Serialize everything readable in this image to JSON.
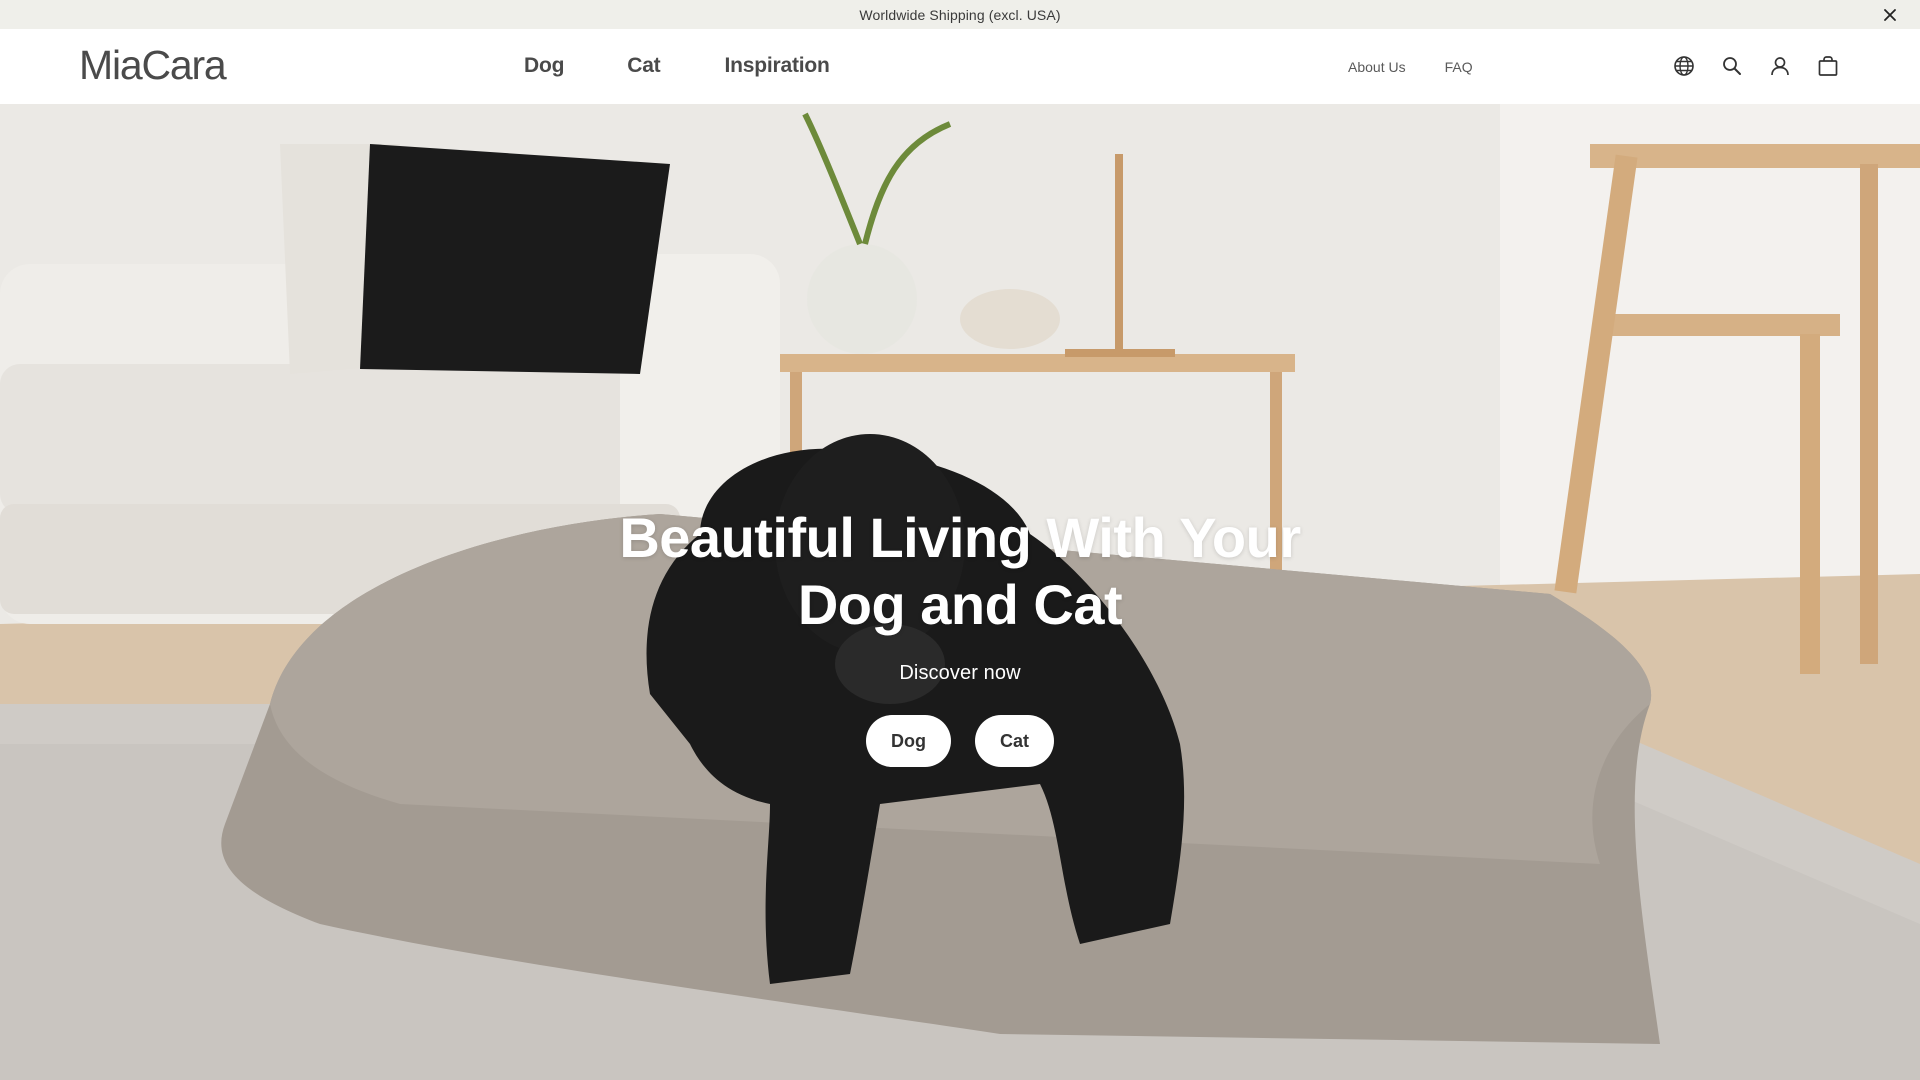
{
  "announcement": {
    "text": "Worldwide Shipping (excl. USA)",
    "close_icon": "close-icon"
  },
  "header": {
    "logo": "MiaCara",
    "main_nav": [
      {
        "label": "Dog"
      },
      {
        "label": "Cat"
      },
      {
        "label": "Inspiration"
      }
    ],
    "secondary_nav": [
      {
        "label": "About Us"
      },
      {
        "label": "FAQ"
      }
    ],
    "icons": [
      "globe-icon",
      "search-icon",
      "account-icon",
      "bag-icon"
    ]
  },
  "hero": {
    "title_line1": "Beautiful Living With Your",
    "title_line2": "Dog and Cat",
    "subtitle": "Discover now",
    "buttons": [
      {
        "label": "Dog"
      },
      {
        "label": "Cat"
      }
    ]
  },
  "colors": {
    "announcement_bg": "#efefea",
    "text_dark": "#4a4a4a",
    "button_bg": "#ffffff"
  }
}
